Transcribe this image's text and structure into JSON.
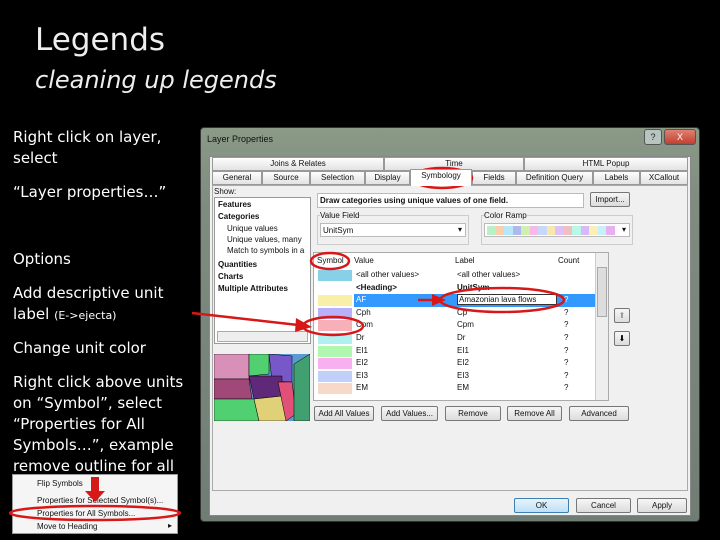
{
  "slide": {
    "title": "Legends",
    "subtitle": "cleaning up legends",
    "bullets": [
      "Right click on layer, select",
      "“Layer properties…”",
      "Options",
      "Add descriptive unit label",
      "(E->ejecta)",
      "Change unit color",
      "Right click above units on “Symbol”, select “Properties for All Symbols…”, example remove outline for all"
    ]
  },
  "dialog": {
    "title": "Layer Properties",
    "help": "?",
    "close": "X",
    "tabs_top": [
      "Joins & Relates",
      "Time",
      "HTML Popup"
    ],
    "tabs_bottom": [
      "General",
      "Source",
      "Selection",
      "Display",
      "Symbology",
      "Fields",
      "Definition Query",
      "Labels",
      "XCallout"
    ],
    "active_tab": "Symbology",
    "show_label": "Show:",
    "show_items": [
      "Features",
      "Categories",
      "Unique values",
      "Unique values, many",
      "Match to symbols in a",
      "Quantities",
      "Charts",
      "Multiple Attributes"
    ],
    "description": "Draw categories using unique values of one field.",
    "import": "Import...",
    "value_field_label": "Value Field",
    "value_field": "UnitSym",
    "color_ramp_label": "Color Ramp",
    "ramp_colors": [
      "#b8f0c8",
      "#f8d0b0",
      "#b8e8f8",
      "#b0b8f0",
      "#d0f0b0",
      "#f8b8e8",
      "#c8d8f8",
      "#f8e8b0",
      "#e0c0f8",
      "#f0c0c0",
      "#b8f8e8",
      "#d8b8f8",
      "#f8f0b8",
      "#c8f0f8",
      "#e8b0f0"
    ],
    "table": {
      "headers": [
        "Symbol",
        "Value",
        "Label",
        "Count"
      ],
      "rows": [
        {
          "color": "#88d0e8",
          "value": "<all other values>",
          "label": "<all other values>",
          "count": ""
        },
        {
          "color": "",
          "value": "<Heading>",
          "label": "UnitSym",
          "count": "",
          "heading": true
        },
        {
          "color": "#f8f0a8",
          "value": "AF",
          "label": "Amazonian lava flows",
          "count": "?",
          "selected": true
        },
        {
          "color": "#b8b0f8",
          "value": "Cph",
          "label": "Cp",
          "count": "?"
        },
        {
          "color": "#f8b0b8",
          "value": "Cpm",
          "label": "Cpm",
          "count": "?"
        },
        {
          "color": "#b0f0f0",
          "value": "Dr",
          "label": "Dr",
          "count": "?"
        },
        {
          "color": "#b0f8b0",
          "value": "EI1",
          "label": "EI1",
          "count": "?"
        },
        {
          "color": "#f8b0f0",
          "value": "EI2",
          "label": "EI2",
          "count": "?"
        },
        {
          "color": "#c0d0f8",
          "value": "EI3",
          "label": "EI3",
          "count": "?"
        },
        {
          "color": "#f8d8c8",
          "value": "EM",
          "label": "EM",
          "count": "?"
        }
      ]
    },
    "buttons": [
      "Add All Values",
      "Add Values...",
      "Remove",
      "Remove All",
      "Advanced"
    ],
    "ok": "OK",
    "cancel": "Cancel",
    "apply": "Apply"
  },
  "context_menu": [
    "Flip Symbols",
    "Properties for Selected Symbol(s)...",
    "Properties for All Symbols...",
    "Move to Heading"
  ],
  "colors": {
    "annotation": "#d81818",
    "selection": "#3399ff"
  }
}
